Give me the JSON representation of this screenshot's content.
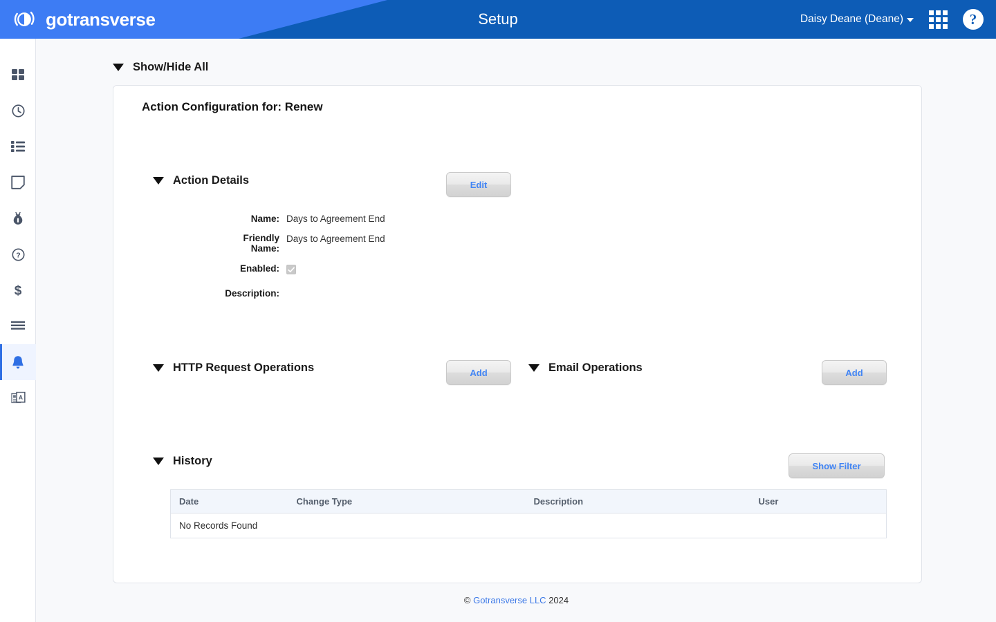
{
  "header": {
    "brand": "gotransverse",
    "title": "Setup",
    "user": "Daisy Deane (Deane)",
    "icons": {
      "logo": "gotransverse-logo-icon",
      "caret": "chevron-down-icon",
      "apps": "apps-grid-icon",
      "help": "?"
    },
    "colors": {
      "bg_dark": "#0d5cb6",
      "bg_light": "#3d7cf4",
      "text": "#ffffff"
    }
  },
  "sidebar": {
    "items": [
      {
        "name": "dashboard-icon",
        "label": "Dashboard",
        "active": false
      },
      {
        "name": "clock-icon",
        "label": "Recent",
        "active": false
      },
      {
        "name": "list-icon",
        "label": "Lists",
        "active": false
      },
      {
        "name": "page-icon",
        "label": "Documents",
        "active": false
      },
      {
        "name": "money-bag-icon",
        "label": "Billing",
        "active": false
      },
      {
        "name": "question-circle-icon",
        "label": "Support",
        "active": false
      },
      {
        "name": "dollar-icon",
        "label": "Payments",
        "active": false
      },
      {
        "name": "menu-lines-icon",
        "label": "Reports",
        "active": false
      },
      {
        "name": "bell-icon",
        "label": "Notifications",
        "active": true
      },
      {
        "name": "newspaper-icon",
        "label": "News",
        "active": false
      }
    ],
    "active_color": "#2f6fe4",
    "active_bg": "#eff4ff"
  },
  "main": {
    "show_hide_all": "Show/Hide All",
    "card_title": "Action Configuration for: Renew",
    "sections": {
      "action_details": {
        "title": "Action Details",
        "edit_button": "Edit",
        "fields": [
          {
            "label": "Name:",
            "value": "Days to Agreement End"
          },
          {
            "label": "Friendly Name:",
            "value": "Days to Agreement End"
          },
          {
            "label": "Enabled:",
            "value": "",
            "type": "checkbox",
            "checked": true
          },
          {
            "label": "Description:",
            "value": ""
          }
        ]
      },
      "http_request_operations": {
        "title": "HTTP Request Operations",
        "add_button": "Add"
      },
      "email_operations": {
        "title": "Email Operations",
        "add_button": "Add"
      },
      "history": {
        "title": "History",
        "filter_button": "Show Filter",
        "columns": [
          "Date",
          "Change Type",
          "Description",
          "User"
        ],
        "empty_message": "No Records Found",
        "rows": []
      }
    }
  },
  "footer": {
    "copyright_symbol": "©",
    "company": "Gotransverse LLC",
    "year": "2024"
  }
}
